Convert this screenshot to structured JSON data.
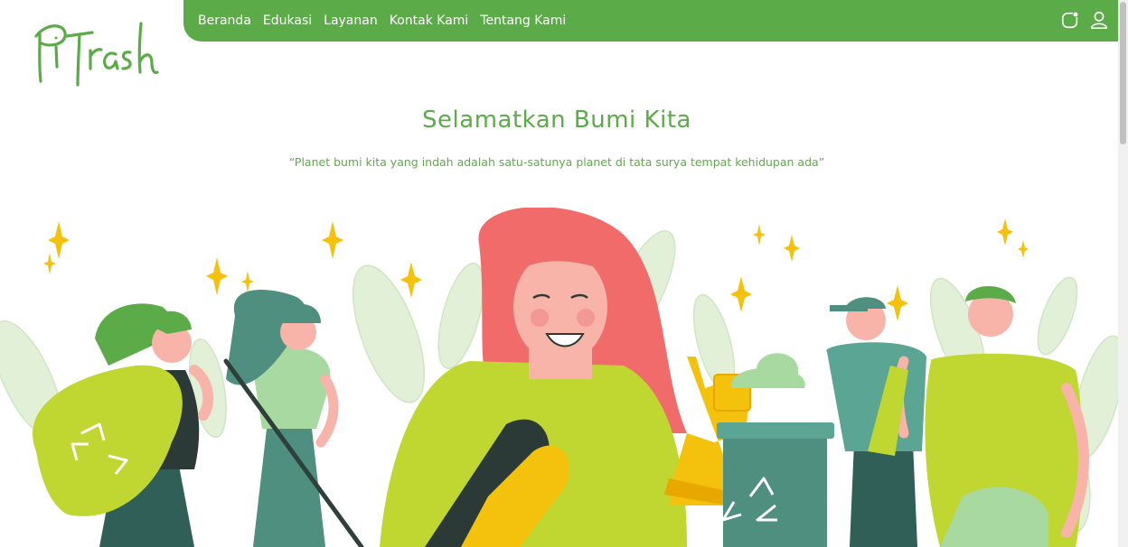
{
  "brand": {
    "logo_text": "PiTrash",
    "color": "#5cab49"
  },
  "nav": {
    "items": [
      "Beranda",
      "Edukasi",
      "Layanan",
      "Kontak Kami",
      "Tentang Kami"
    ],
    "icons": [
      "notification-bell-icon",
      "user-profile-icon"
    ]
  },
  "hero": {
    "title": "Selamatkan Bumi Kita",
    "quote": "“Planet bumi kita yang indah adalah satu-satunya planet di tata surya tempat kehidupan ada”"
  },
  "colors": {
    "primary_green": "#5cab49",
    "lime": "#bfd730",
    "teal": "#4f8f80",
    "salmon": "#f26b6b",
    "yellow": "#f4c20d",
    "leaf": "#e2f0d8"
  }
}
